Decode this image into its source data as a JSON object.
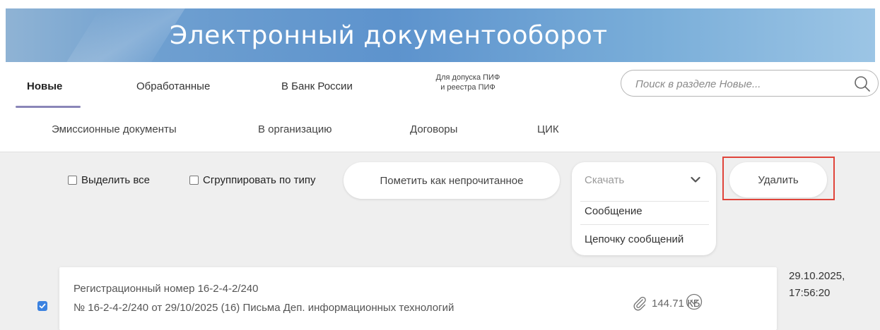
{
  "header": {
    "title": "Электронный документооборот"
  },
  "tabs_row1": [
    {
      "label": "Новые",
      "active": true
    },
    {
      "label": "Обработанные"
    },
    {
      "label": "В Банк России"
    },
    {
      "line1": "Для допуска ПИФ",
      "line2": "и реестра ПИФ"
    }
  ],
  "tabs_row2": [
    {
      "label": "Эмиссионные документы"
    },
    {
      "label": "В организацию"
    },
    {
      "label": "Договоры"
    },
    {
      "label": "ЦИК"
    }
  ],
  "search": {
    "placeholder": "Поиск в разделе Новые...",
    "icon": "search-icon"
  },
  "toolbar": {
    "select_all": "Выделить все",
    "group_by_type": "Сгруппировать по типу",
    "mark_unread": "Пометить как непрочитанное",
    "download": {
      "label": "Скачать",
      "options": [
        "Сообщение",
        "Цепочку сообщений"
      ]
    },
    "delete": "Удалить"
  },
  "documents": [
    {
      "checked": true,
      "reg_number": "Регистрационный номер 16-2-4-2/240",
      "description": "№ 16-2-4-2/240 от 29/10/2025 (16) Письма Деп. информационных технологий",
      "size": "144.71 КБ",
      "date": "29.10.2025,",
      "time": "17:56:20"
    }
  ],
  "colors": {
    "accent_underline": "#8a86b8",
    "highlight_border": "#e0443a",
    "checkbox_checked": "#3b82e0"
  }
}
